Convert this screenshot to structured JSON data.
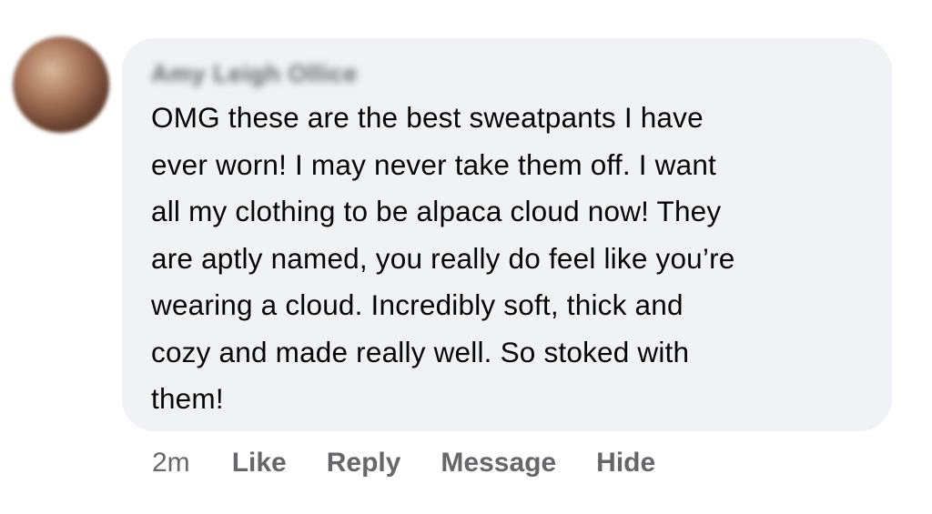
{
  "comment": {
    "author": "Amy Leigh Ollice",
    "text": "OMG these are the best sweatpants I have\never worn!  I may never take them off. I want\nall my clothing to be alpaca cloud now! They\nare aptly named, you really do feel like you’re\nwearing a cloud. Incredibly soft, thick and\ncozy and made really well. So stoked with\nthem!"
  },
  "actions": {
    "timestamp": "2m",
    "like": "Like",
    "reply": "Reply",
    "message": "Message",
    "hide": "Hide"
  },
  "colors": {
    "bubble_background": "#f0f2f5",
    "text": "#050505",
    "secondary_text": "#65676b"
  }
}
